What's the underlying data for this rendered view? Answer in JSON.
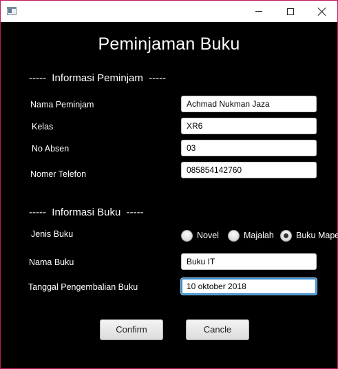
{
  "window": {
    "title": "",
    "controls": {
      "minimize": "minimize-icon",
      "maximize": "maximize-icon",
      "close": "close-icon"
    }
  },
  "form": {
    "heading": "Peminjaman Buku",
    "borrower_section": "-----  Informasi Peminjam  -----",
    "book_section": "-----  Informasi Buku  -----",
    "fields": {
      "nama_peminjam": {
        "label": "Nama Peminjam",
        "value": "Achmad Nukman Jaza"
      },
      "kelas": {
        "label": "Kelas",
        "value": "XR6"
      },
      "no_absen": {
        "label": "No Absen",
        "value": "03"
      },
      "nomer_telefon": {
        "label": "Nomer Telefon",
        "value": "085854142760"
      },
      "nama_buku": {
        "label": "Nama Buku",
        "value": "Buku IT"
      },
      "tanggal_pengembalian": {
        "label": "Tanggal Pengembalian Buku",
        "value": "10 oktober 2018"
      }
    },
    "jenis_buku": {
      "label": "Jenis Buku",
      "options": [
        {
          "label": "Novel",
          "selected": false
        },
        {
          "label": "Majalah",
          "selected": false
        },
        {
          "label": "Buku Mapel",
          "selected": true
        }
      ]
    },
    "buttons": {
      "confirm": "Confirm",
      "cancel": "Cancle"
    }
  },
  "colors": {
    "background": "#000000",
    "focus_accent": "#3a8fcf",
    "window_border": "#c2185b"
  }
}
